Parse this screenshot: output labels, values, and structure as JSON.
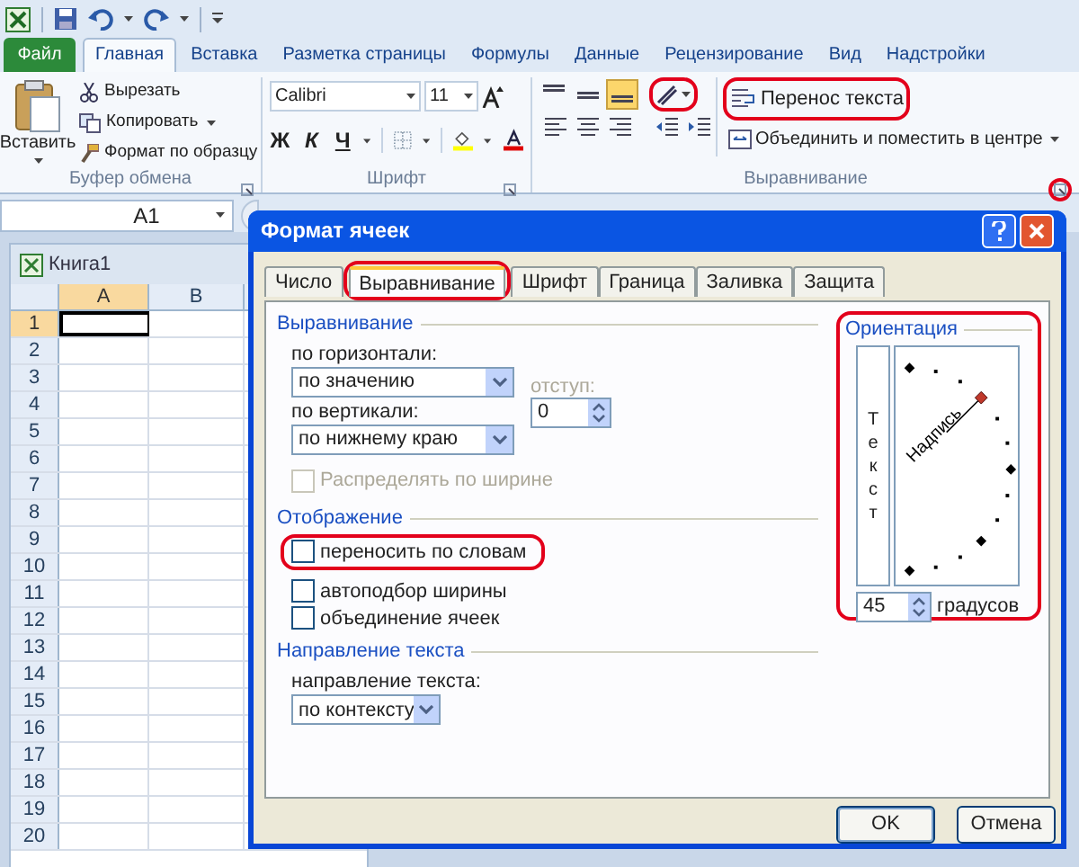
{
  "ribbon": {
    "tabs": [
      {
        "label": "Файл",
        "kind": "file",
        "selected": false
      },
      {
        "label": "Главная",
        "kind": "tab",
        "selected": true
      },
      {
        "label": "Вставка",
        "kind": "tab",
        "selected": false
      },
      {
        "label": "Разметка страницы",
        "kind": "tab",
        "selected": false
      },
      {
        "label": "Формулы",
        "kind": "tab",
        "selected": false
      },
      {
        "label": "Данные",
        "kind": "tab",
        "selected": false
      },
      {
        "label": "Рецензирование",
        "kind": "tab",
        "selected": false
      },
      {
        "label": "Вид",
        "kind": "tab",
        "selected": false
      },
      {
        "label": "Надстройки",
        "kind": "tab",
        "selected": false
      }
    ],
    "clipboard": {
      "label": "Буфер обмена",
      "paste": "Вставить",
      "cut": "Вырезать",
      "copy": "Копировать",
      "format_painter": "Формат по образцу"
    },
    "font": {
      "label": "Шрифт",
      "font_name": "Calibri",
      "font_size": "11",
      "bold": "Ж",
      "italic": "К",
      "underline": "Ч"
    },
    "alignment": {
      "label": "Выравнивание",
      "vertical_buttons": [
        {
          "kind": "top",
          "selected": false
        },
        {
          "kind": "middle",
          "selected": false
        },
        {
          "kind": "bottom",
          "selected": true
        }
      ],
      "orientation_button": {
        "highlighted": true
      },
      "wrap_text": {
        "label": "Перенос текста",
        "highlighted": true
      },
      "merge": "Объединить и поместить в центре",
      "launcher": {
        "highlighted": true
      }
    }
  },
  "formula_bar": {
    "name_box": "A1"
  },
  "workbook": {
    "title": "Книга1",
    "columns": [
      {
        "label": "A",
        "selected": true
      },
      {
        "label": "B",
        "selected": false
      }
    ],
    "rows": [
      {
        "label": "1",
        "selected": true
      },
      {
        "label": "2",
        "selected": false
      },
      {
        "label": "3",
        "selected": false
      },
      {
        "label": "4",
        "selected": false
      },
      {
        "label": "5",
        "selected": false
      },
      {
        "label": "6",
        "selected": false
      },
      {
        "label": "7",
        "selected": false
      },
      {
        "label": "8",
        "selected": false
      },
      {
        "label": "9",
        "selected": false
      },
      {
        "label": "10",
        "selected": false
      },
      {
        "label": "11",
        "selected": false
      },
      {
        "label": "12",
        "selected": false
      },
      {
        "label": "13",
        "selected": false
      },
      {
        "label": "14",
        "selected": false
      },
      {
        "label": "15",
        "selected": false
      },
      {
        "label": "16",
        "selected": false
      },
      {
        "label": "17",
        "selected": false
      },
      {
        "label": "18",
        "selected": false
      },
      {
        "label": "19",
        "selected": false
      },
      {
        "label": "20",
        "selected": false
      }
    ]
  },
  "dialog": {
    "title": "Формат ячеек",
    "tabs": [
      {
        "label": "Число",
        "selected": false,
        "highlighted": false
      },
      {
        "label": "Выравнивание",
        "selected": true,
        "highlighted": true
      },
      {
        "label": "Шрифт",
        "selected": false,
        "highlighted": false
      },
      {
        "label": "Граница",
        "selected": false,
        "highlighted": false
      },
      {
        "label": "Заливка",
        "selected": false,
        "highlighted": false
      },
      {
        "label": "Защита",
        "selected": false,
        "highlighted": false
      }
    ],
    "alignment": {
      "title": "Выравнивание",
      "horizontal_label": "по горизонтали:",
      "horizontal_value": "по значению",
      "indent_label": "отступ:",
      "indent_value": "0",
      "vertical_label": "по вертикали:",
      "vertical_value": "по нижнему краю",
      "justify_distributed": {
        "label": "Распределять по ширине",
        "checked": false,
        "disabled": true
      }
    },
    "display": {
      "title": "Отображение",
      "options": [
        {
          "label": "переносить по словам",
          "checked": false,
          "highlighted": true
        },
        {
          "label": "автоподбор ширины",
          "checked": false,
          "highlighted": false
        },
        {
          "label": "объединение ячеек",
          "checked": false,
          "highlighted": false
        }
      ]
    },
    "text_direction": {
      "title": "Направление текста",
      "label": "направление текста:",
      "value": "по контексту"
    },
    "orientation": {
      "title": "Ориентация",
      "vertical_text": "Текст",
      "dial_text": "Надпись",
      "degrees": "45",
      "degrees_label": "градусов",
      "highlighted": true
    },
    "buttons": [
      {
        "label": "OK",
        "kind": "default"
      },
      {
        "label": "Отмена",
        "kind": "normal"
      }
    ]
  }
}
